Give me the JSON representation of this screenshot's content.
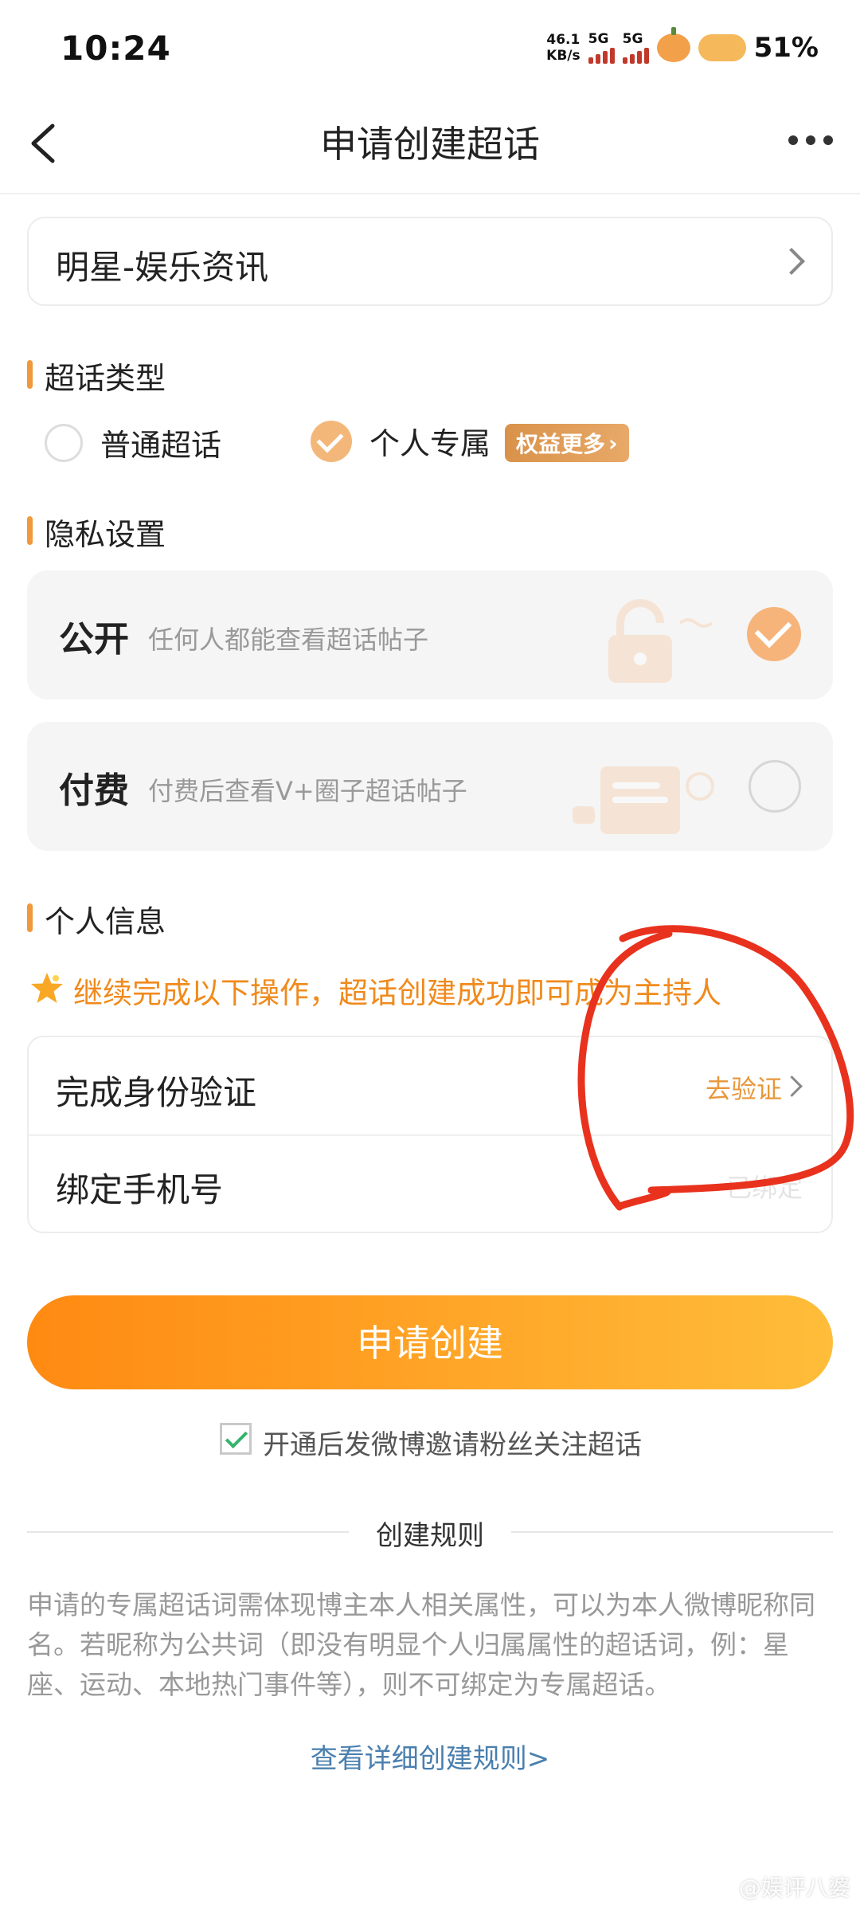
{
  "status_bar": {
    "time": "10:24",
    "net_speed_value": "46.1",
    "net_speed_unit": "KB/s",
    "signal_1_label": "5G",
    "signal_2_label": "5G",
    "battery": "51%"
  },
  "header": {
    "title": "申请创建超话"
  },
  "category": {
    "value": "明星-娱乐资讯"
  },
  "topic_type": {
    "section_title": "超话类型",
    "option_normal": "普通超话",
    "option_personal": "个人专属",
    "badge": "权益更多",
    "selected": "个人专属"
  },
  "privacy": {
    "section_title": "隐私设置",
    "public_title": "公开",
    "public_desc": "任何人都能查看超话帖子",
    "paid_title": "付费",
    "paid_desc": "付费后查看V+圈子超话帖子",
    "selected": "公开"
  },
  "personal_info": {
    "section_title": "个人信息",
    "notice": "继续完成以下操作，超话创建成功即可成为主持人",
    "identity_label": "完成身份验证",
    "identity_action": "去验证",
    "phone_label": "绑定手机号",
    "phone_status": "已绑定"
  },
  "actions": {
    "create_button": "申请创建",
    "invite_checkbox_label": "开通后发微博邀请粉丝关注超话",
    "invite_checked": true
  },
  "rules": {
    "title": "创建规则",
    "body": "申请的专属超话词需体现博主本人相关属性，可以为本人微博昵称同名。若昵称为公共词（即没有明显个人归属属性的超话词，例：星座、运动、本地热门事件等），则不可绑定为专属超话。",
    "link": "查看详细创建规则>"
  },
  "watermark": "@娱评八婆",
  "colors": {
    "accent": "#f08a1c",
    "button_start": "#ff8a12",
    "button_end": "#ffbd3a",
    "annotation": "#e8321e",
    "link": "#4a7fae"
  }
}
